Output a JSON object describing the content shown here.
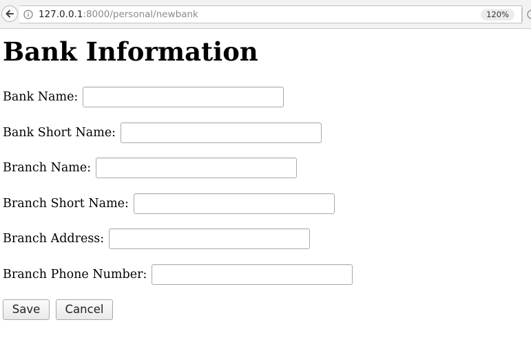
{
  "browser": {
    "url_host": "127.0.0.1",
    "url_path": ":8000/personal/newbank",
    "zoom": "120%"
  },
  "page": {
    "title": "Bank Information"
  },
  "form": {
    "fields": [
      {
        "label": "Bank Name:",
        "value": "",
        "placeholder": ""
      },
      {
        "label": "Bank Short Name:",
        "value": "",
        "placeholder": ""
      },
      {
        "label": "Branch Name:",
        "value": "",
        "placeholder": ""
      },
      {
        "label": "Branch Short Name:",
        "value": "",
        "placeholder": ""
      },
      {
        "label": "Branch Address:",
        "value": "",
        "placeholder": ""
      },
      {
        "label": "Branch Phone Number:",
        "value": "",
        "placeholder": ""
      }
    ],
    "save_label": "Save",
    "cancel_label": "Cancel"
  },
  "colors": {
    "chrome_bg": "#f2f2f2",
    "input_border": "#a9a9a9",
    "text": "#000000"
  }
}
